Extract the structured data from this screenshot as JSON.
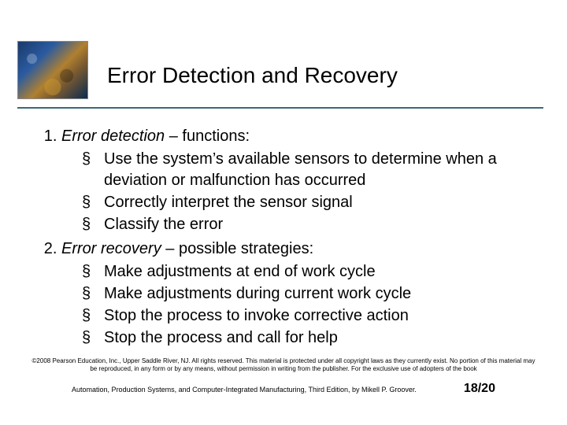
{
  "title": "Error Detection and Recovery",
  "items": [
    {
      "lead_em": "Error detection",
      "lead_rest": " – functions:",
      "bullets": [
        "Use the system’s available sensors to determine when a deviation or malfunction has occurred",
        "Correctly interpret the sensor signal",
        "Classify the error"
      ]
    },
    {
      "lead_em": "Error recovery",
      "lead_rest": " – possible strategies:",
      "bullets": [
        "Make adjustments at end of work cycle",
        "Make adjustments during current work cycle",
        "Stop the process to invoke corrective action",
        "Stop the process and call for help"
      ]
    }
  ],
  "footer": {
    "copyright": "©2008 Pearson Education, Inc., Upper Saddle River, NJ. All rights reserved. This material is protected under all copyright laws as they currently exist. No portion of this material may be reproduced, in any form or by any means, without permission in writing from the publisher. For the exclusive use of adopters of the book",
    "citation": "Automation, Production Systems, and Computer-Integrated Manufacturing, Third Edition, by Mikell P. Groover.",
    "page": "18/20"
  }
}
